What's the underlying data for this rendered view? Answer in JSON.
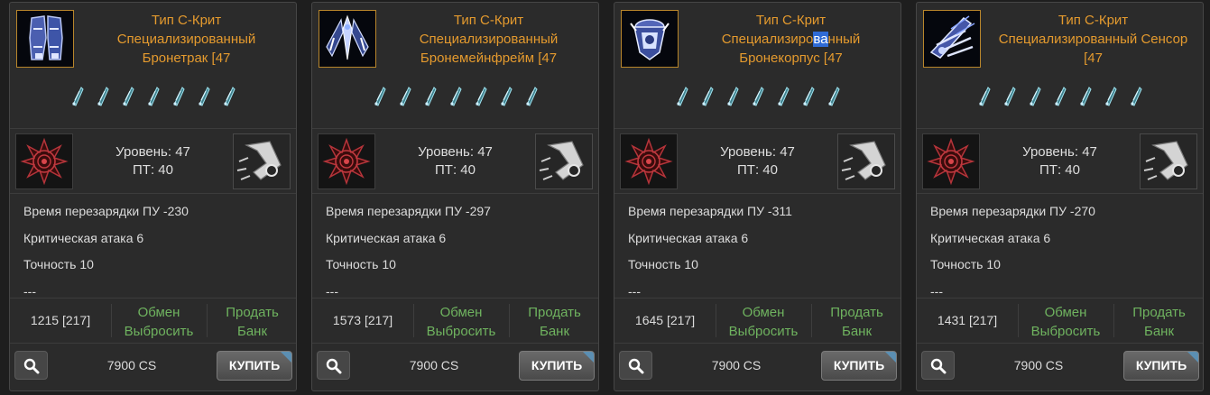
{
  "colors": {
    "title": "#e49a2e",
    "link": "#6fb35f",
    "text": "#dcdcdc",
    "card_bg": "#2b2b2b",
    "frame": "#b8862b"
  },
  "cards": [
    {
      "title_lines": [
        "Тип С-Крит",
        "Специализированный",
        "Бронетрак [47"
      ],
      "title_highlight": null,
      "image": "armor-legs-icon",
      "sockets": 7,
      "level": "Уровень: 47",
      "pt": "ПТ: 40",
      "stats": [
        "Время перезарядки ПУ -230",
        "Критическая атака 6",
        "Точность 10",
        "---"
      ],
      "price": "1215 [217]",
      "exchange": "Обмен",
      "drop": "Выбросить",
      "sell": "Продать",
      "bank": "Банк",
      "cost": "7900 CS",
      "buy": "КУПИТЬ"
    },
    {
      "title_lines": [
        "Тип С-Крит",
        "Специализированный",
        "Бронемейнфрейм [47"
      ],
      "title_highlight": null,
      "image": "armor-mainframe-icon",
      "sockets": 7,
      "level": "Уровень: 47",
      "pt": "ПТ: 40",
      "stats": [
        "Время перезарядки ПУ -297",
        "Критическая атака 6",
        "Точность 10",
        "---"
      ],
      "price": "1573 [217]",
      "exchange": "Обмен",
      "drop": "Выбросить",
      "sell": "Продать",
      "bank": "Банк",
      "cost": "7900 CS",
      "buy": "КУПИТЬ"
    },
    {
      "title_lines": [
        "Тип С-Крит",
        "Специализированный",
        "Бронекорпус [47"
      ],
      "title_highlight": {
        "line": 1,
        "before": "Специализиро",
        "mark": "ва",
        "after": "нный"
      },
      "image": "armor-body-icon",
      "sockets": 7,
      "level": "Уровень: 47",
      "pt": "ПТ: 40",
      "stats": [
        "Время перезарядки ПУ -311",
        "Критическая атака 6",
        "Точность 10",
        "---"
      ],
      "price": "1645 [217]",
      "exchange": "Обмен",
      "drop": "Выбросить",
      "sell": "Продать",
      "bank": "Банк",
      "cost": "7900 CS",
      "buy": "КУПИТЬ"
    },
    {
      "title_lines": [
        "Тип С-Крит",
        "Специализированный Сенсор",
        "[47"
      ],
      "title_highlight": null,
      "image": "armor-sensor-icon",
      "sockets": 7,
      "level": "Уровень: 47",
      "pt": "ПТ: 40",
      "stats": [
        "Время перезарядки ПУ -270",
        "Критическая атака 6",
        "Точность 10",
        "---"
      ],
      "price": "1431 [217]",
      "exchange": "Обмен",
      "drop": "Выбросить",
      "sell": "Продать",
      "bank": "Банк",
      "cost": "7900 CS",
      "buy": "КУПИТЬ"
    }
  ]
}
